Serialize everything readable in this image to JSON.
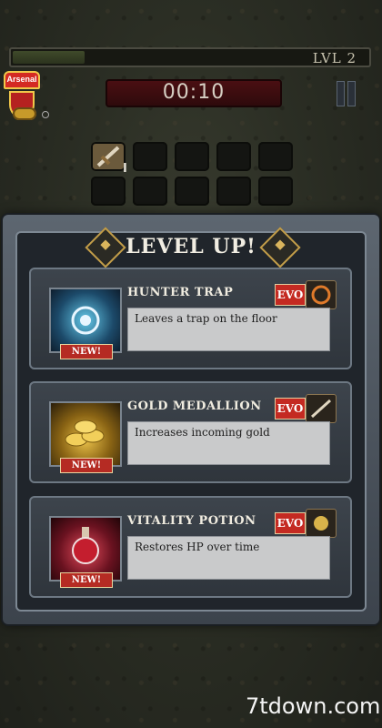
{
  "hud": {
    "level_label": "LVL 2",
    "timer": "00:10",
    "crest_text": "Arsenal",
    "xp_fraction": 0.2,
    "weapon_level": "I"
  },
  "level_up": {
    "title": "LEVEL UP!",
    "options": [
      {
        "name": "HUNTER TRAP",
        "description": "Leaves a trap on the floor",
        "badge": "NEW!",
        "evo_label": "EVO",
        "icon": "trap-icon",
        "evo_icon": "fire-ring-icon"
      },
      {
        "name": "GOLD MEDALLION",
        "description": "Increases incoming gold",
        "badge": "NEW!",
        "evo_label": "EVO",
        "icon": "gold-coins-icon",
        "evo_icon": "dagger-icon"
      },
      {
        "name": "VITALITY POTION",
        "description": "Restores HP over time",
        "badge": "NEW!",
        "evo_label": "EVO",
        "icon": "potion-icon",
        "evo_icon": "sun-icon"
      }
    ]
  },
  "watermark": "7tdown.com",
  "colors": {
    "accent_red": "#c42a22",
    "gold": "#c29d49",
    "panel": "#20252b"
  }
}
